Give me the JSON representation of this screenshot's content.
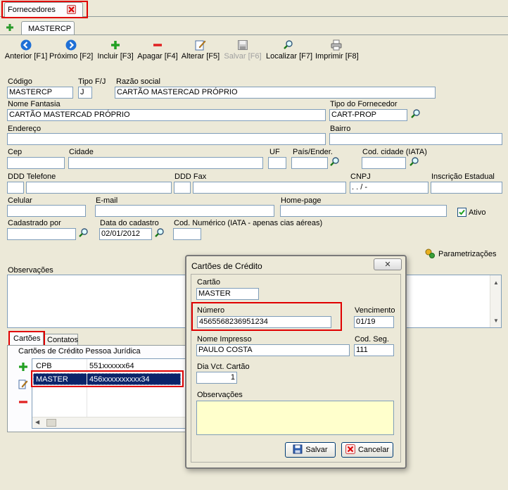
{
  "top_tab": {
    "label": "Fornecedores"
  },
  "sub_tab": {
    "label": "MASTERCP"
  },
  "toolbar": {
    "anterior": "Anterior [F1]",
    "proximo": "Próximo [F2]",
    "incluir": "Incluir [F3]",
    "apagar": "Apagar [F4]",
    "alterar": "Alterar [F5]",
    "salvar": "Salvar [F6]",
    "localizar": "Localizar [F7]",
    "imprimir": "Imprimir [F8]"
  },
  "form": {
    "codigo": {
      "label": "Código",
      "value": "MASTERCP"
    },
    "tipo_fj": {
      "label": "Tipo F/J",
      "value": "J"
    },
    "razao_social": {
      "label": "Razão social",
      "value": "CARTÃO MASTERCAD PRÓPRIO"
    },
    "nome_fantasia": {
      "label": "Nome Fantasia",
      "value": "CARTÃO MASTERCAD PRÓPRIO"
    },
    "tipo_fornecedor": {
      "label": "Tipo do Fornecedor",
      "value": "CART-PROP"
    },
    "endereco": {
      "label": "Endereço",
      "value": ""
    },
    "bairro": {
      "label": "Bairro",
      "value": ""
    },
    "cep": {
      "label": "Cep",
      "value": ""
    },
    "cidade": {
      "label": "Cidade",
      "value": ""
    },
    "uf": {
      "label": "UF",
      "value": ""
    },
    "pais": {
      "label": "País/Ender.",
      "value": ""
    },
    "cod_cidade": {
      "label": "Cod. cidade (IATA)",
      "value": ""
    },
    "ddd_telefone": {
      "label": "DDD Telefone",
      "value": ""
    },
    "ddd_fax": {
      "label": "DDD Fax",
      "value": ""
    },
    "cnpj": {
      "label": "CNPJ",
      "value": " .   .   /   -"
    },
    "inscricao_estadual": {
      "label": "Inscrição Estadual",
      "value": ""
    },
    "celular": {
      "label": "Celular",
      "value": ""
    },
    "email": {
      "label": "E-mail",
      "value": ""
    },
    "homepage": {
      "label": "Home-page",
      "value": ""
    },
    "ativo": {
      "label": "Ativo",
      "checked": true
    },
    "cadastrado_por": {
      "label": "Cadastrado por",
      "value": ""
    },
    "data_cadastro": {
      "label": "Data do cadastro",
      "value": "02/01/2012"
    },
    "cod_numerico": {
      "label": "Cod. Numérico (IATA - apenas cias aéreas)",
      "value": ""
    },
    "parametrizacoes": "Parametrizações",
    "observacoes": {
      "label": "Observações",
      "value": ""
    }
  },
  "bottom_tabs": {
    "cartoes": "Cartões",
    "contatos": "Contatos"
  },
  "cards_group": {
    "title": "Cartões de Crédito Pessoa Jurídica",
    "rows": [
      {
        "name": "CPB",
        "number": "551xxxxxx64"
      },
      {
        "name": "MASTER",
        "number": "456xxxxxxxxxx34"
      }
    ]
  },
  "dialog": {
    "title": "Cartões de Crédito",
    "cartao": {
      "label": "Cartão",
      "value": "MASTER"
    },
    "numero": {
      "label": "Número",
      "value": "4565568236951234"
    },
    "vencimento": {
      "label": "Vencimento",
      "value": "01/19"
    },
    "nome_impresso": {
      "label": "Nome Impresso",
      "value": "PAULO COSTA"
    },
    "cod_seg": {
      "label": "Cod. Seg.",
      "value": "111"
    },
    "dia_vct": {
      "label": "Dia Vct. Cartão",
      "value": "1"
    },
    "observacoes": {
      "label": "Observações",
      "value": ""
    },
    "salvar": "Salvar",
    "cancelar": "Cancelar"
  },
  "colors": {
    "highlight": "#e00000",
    "selection": "#0a246a",
    "memo_bg": "#ffffcc"
  }
}
